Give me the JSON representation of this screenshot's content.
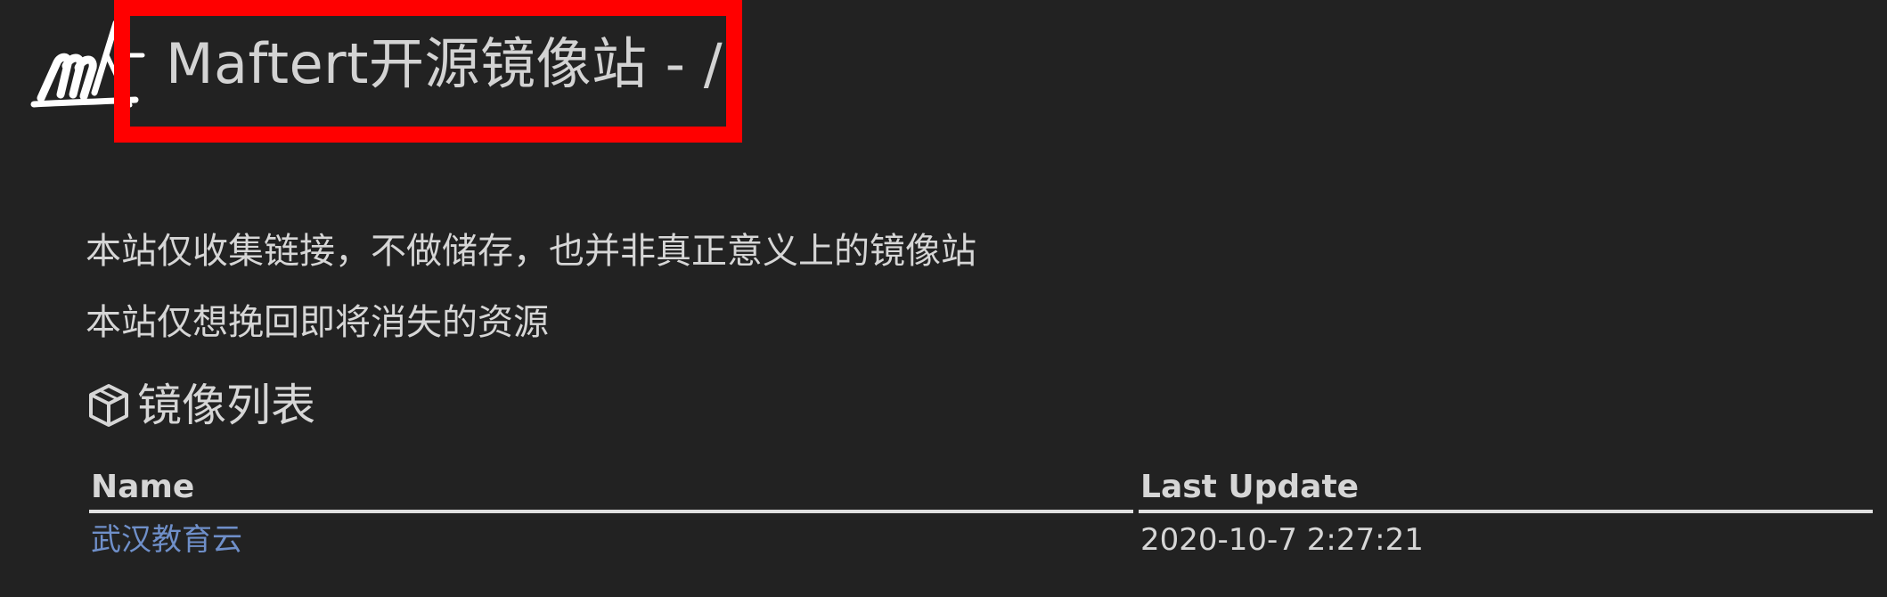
{
  "header": {
    "title": "Maftert开源镜像站 - /",
    "logo_icon": "maftert-logo-icon",
    "highlight_color": "#ff0000"
  },
  "notices": [
    "本站仅收集链接，不做储存，也并非真正意义上的镜像站",
    "本站仅想挽回即将消失的资源"
  ],
  "section": {
    "icon": "box-icon",
    "heading": "镜像列表"
  },
  "table": {
    "headers": {
      "name": "Name",
      "last_update": "Last Update"
    },
    "rows": [
      {
        "name": "武汉教育云",
        "last_update": "2020-10-7 2:27:21"
      }
    ]
  },
  "colors": {
    "background": "#222222",
    "text": "#d6d6d6",
    "link": "#6f8fc9"
  }
}
